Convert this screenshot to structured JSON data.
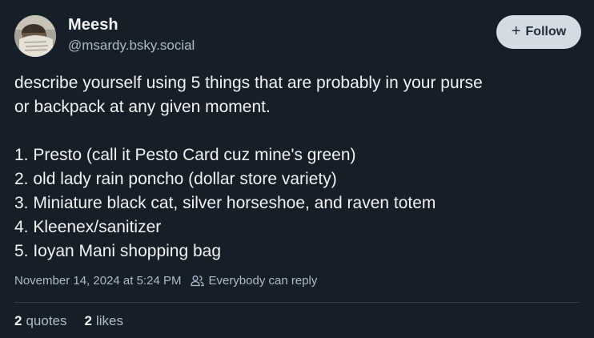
{
  "author": {
    "display_name": "Meesh",
    "handle": "@msardy.bsky.social"
  },
  "follow_button": {
    "icon": "plus-icon",
    "icon_glyph": "+",
    "label": "Follow"
  },
  "post": {
    "intro_lines": [
      "describe yourself using 5 things that are probably in your purse",
      "or backpack at any given moment."
    ],
    "list_items": [
      "1. Presto (call it Pesto Card cuz mine's green)",
      "2. old lady rain poncho (dollar store variety)",
      "3. Miniature black cat, silver horseshoe, and raven totem",
      "4. Kleenex/sanitizer",
      "5. Ioyan Mani shopping bag"
    ]
  },
  "meta": {
    "timestamp": "November 14, 2024 at 5:24 PM",
    "reply_icon": "people-icon",
    "reply_setting": "Everybody can reply"
  },
  "stats": {
    "quotes_count": "2",
    "quotes_label": "quotes",
    "likes_count": "2",
    "likes_label": "likes"
  },
  "colors": {
    "background": "#161e27",
    "text_primary": "#f1f3f5",
    "text_secondary": "#aebbc9",
    "follow_button_bg": "#d4dbe2",
    "divider": "#2e3a47"
  }
}
